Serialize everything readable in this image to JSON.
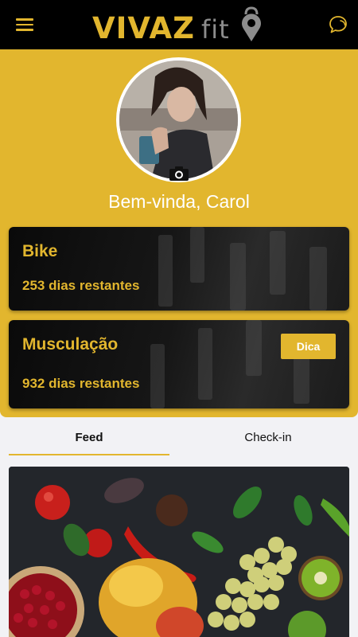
{
  "header": {
    "logo_text": "VIVAZ",
    "logo_suffix": "fit",
    "menu_icon": "hamburger-menu-icon",
    "chat_icon": "chat-bubbles-icon"
  },
  "profile": {
    "welcome": "Bem-vinda, Carol",
    "camera_icon": "camera-icon"
  },
  "plans": [
    {
      "name": "Bike",
      "remaining": "253 dias restantes"
    },
    {
      "name": "Musculação",
      "remaining": "932 dias restantes",
      "tip_label": "Dica"
    }
  ],
  "tabs": [
    {
      "label": "Feed",
      "active": true
    },
    {
      "label": "Check-in",
      "active": false
    }
  ],
  "colors": {
    "accent": "#e2b62e",
    "topbar": "#000000",
    "card": "#111111"
  }
}
